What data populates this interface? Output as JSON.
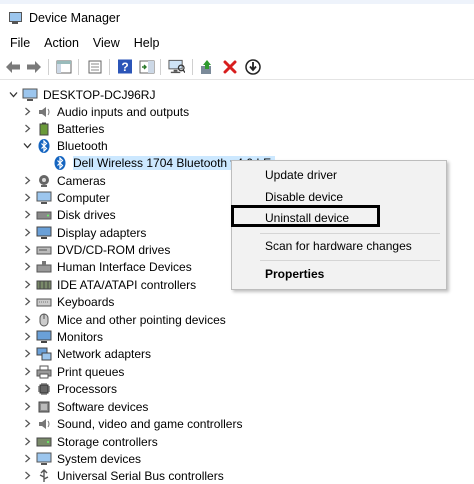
{
  "window": {
    "title": "Device Manager"
  },
  "menu": {
    "file": "File",
    "action": "Action",
    "view": "View",
    "help": "Help"
  },
  "toolbar": {
    "icons": [
      "back-icon",
      "forward-icon",
      "show-hide-tree-icon",
      "properties-icon",
      "help-icon",
      "action-pane-icon",
      "scan-hardware-icon",
      "add-driver-icon",
      "uninstall-x-icon",
      "update-driver-icon"
    ]
  },
  "tree": {
    "root": "DESKTOP-DCJ96RJ",
    "items": [
      {
        "label": "Audio inputs and outputs",
        "icon": "speaker-icon"
      },
      {
        "label": "Batteries",
        "icon": "battery-icon"
      },
      {
        "label": "Bluetooth",
        "icon": "bluetooth-icon",
        "expanded": true
      },
      {
        "label": "Cameras",
        "icon": "camera-icon"
      },
      {
        "label": "Computer",
        "icon": "computer-icon"
      },
      {
        "label": "Disk drives",
        "icon": "disk-icon"
      },
      {
        "label": "Display adapters",
        "icon": "display-icon"
      },
      {
        "label": "DVD/CD-ROM drives",
        "icon": "dvd-icon"
      },
      {
        "label": "Human Interface Devices",
        "icon": "hid-icon"
      },
      {
        "label": "IDE ATA/ATAPI controllers",
        "icon": "ide-icon"
      },
      {
        "label": "Keyboards",
        "icon": "keyboard-icon"
      },
      {
        "label": "Mice and other pointing devices",
        "icon": "mouse-icon"
      },
      {
        "label": "Monitors",
        "icon": "monitor-icon"
      },
      {
        "label": "Network adapters",
        "icon": "network-icon"
      },
      {
        "label": "Print queues",
        "icon": "printer-icon"
      },
      {
        "label": "Processors",
        "icon": "processor-icon"
      },
      {
        "label": "Software devices",
        "icon": "software-icon"
      },
      {
        "label": "Sound, video and game controllers",
        "icon": "sound-icon"
      },
      {
        "label": "Storage controllers",
        "icon": "storage-icon"
      },
      {
        "label": "System devices",
        "icon": "system-icon"
      },
      {
        "label": "Universal Serial Bus controllers",
        "icon": "usb-icon"
      }
    ],
    "bluetooth_child": "Dell Wireless 1704 Bluetooth v4.0 LE"
  },
  "context_menu": {
    "update_driver": "Update driver",
    "disable_device": "Disable device",
    "uninstall_device": "Uninstall device",
    "scan_hardware": "Scan for hardware changes",
    "properties": "Properties"
  },
  "colors": {
    "selection": "#cce8ff",
    "highlight_box": "#000000",
    "uninstall_red": "#d81e1e",
    "help_blue": "#2b55b8"
  }
}
